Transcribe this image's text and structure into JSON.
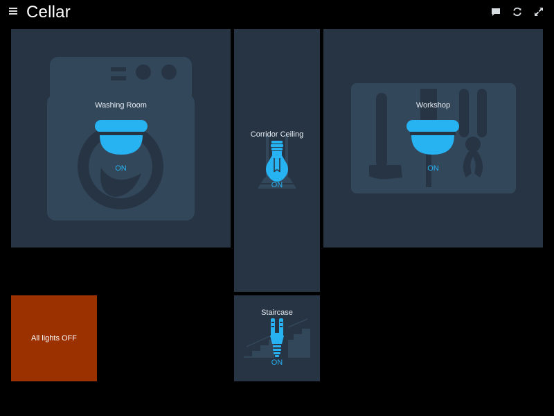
{
  "header": {
    "title": "Cellar",
    "icons": [
      "menu-icon",
      "comment-icon",
      "refresh-icon",
      "fullscreen-icon"
    ]
  },
  "tiles": {
    "washing_room": {
      "label": "Washing Room",
      "state": "ON",
      "icon": "ceiling-light-icon",
      "background": "washing-machine"
    },
    "corridor": {
      "label": "Corridor Ceiling",
      "state": "ON",
      "icon": "light-bulb-icon",
      "background": "corridor"
    },
    "workshop": {
      "label": "Workshop",
      "state": "ON",
      "icon": "ceiling-light-icon",
      "background": "tools"
    },
    "staircase": {
      "label": "Staircase",
      "state": "ON",
      "icon": "cfl-bulb-icon",
      "background": "stairs"
    },
    "all_off": {
      "label": "All lights OFF"
    }
  },
  "colors": {
    "background": "#000000",
    "tile": "#263444",
    "tile_graphic": "#33475b",
    "accent": "#27b3f2",
    "all_off": "#9c3100"
  }
}
